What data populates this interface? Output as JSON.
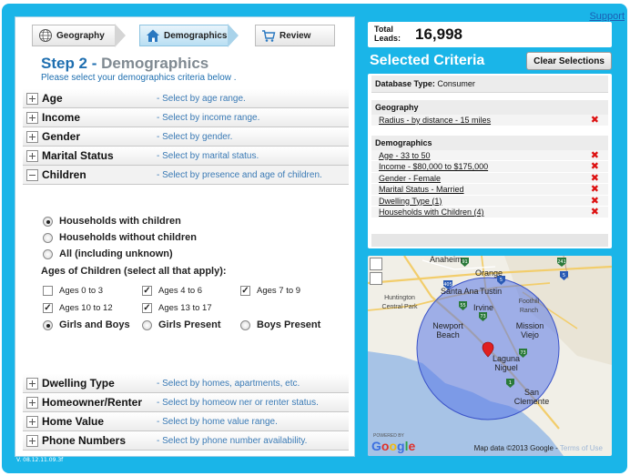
{
  "header": {
    "support_link": "Support"
  },
  "version": "V. 08.12.11.09.3f",
  "steps": [
    {
      "label": "Geography",
      "icon": "globe-icon"
    },
    {
      "label": "Demographics",
      "icon": "house-icon"
    },
    {
      "label": "Review",
      "icon": "cart-icon"
    }
  ],
  "step_heading": {
    "prefix": "Step 2",
    "sep": " - ",
    "name": "Demographics"
  },
  "step_subtitle": "Please select your demographics criteria below .",
  "criteria_rows_top": [
    {
      "label": "Age",
      "hint": "- Select by age range."
    },
    {
      "label": "Income",
      "hint": "- Select by income range."
    },
    {
      "label": "Gender",
      "hint": "- Select by gender."
    },
    {
      "label": "Marital Status",
      "hint": "- Select by marital status."
    },
    {
      "label": "Children",
      "hint": "- Select by presence and age of children."
    }
  ],
  "children": {
    "household_options": [
      {
        "label": "Households with children",
        "selected": true
      },
      {
        "label": "Households without children",
        "selected": false
      },
      {
        "label": "All (including unknown)",
        "selected": false
      }
    ],
    "ages_title": "Ages of Children (select all that apply):",
    "age_checks": [
      {
        "label": "Ages 0 to 3",
        "checked": false
      },
      {
        "label": "Ages 4 to 6",
        "checked": true
      },
      {
        "label": "Ages 7 to 9",
        "checked": true
      },
      {
        "label": "Ages 10 to 12",
        "checked": true
      },
      {
        "label": "Ages 13 to 17",
        "checked": true
      }
    ],
    "gender_options": [
      {
        "label": "Girls and Boys",
        "selected": true
      },
      {
        "label": "Girls Present",
        "selected": false
      },
      {
        "label": "Boys Present",
        "selected": false
      }
    ]
  },
  "criteria_rows_bottom": [
    {
      "label": "Dwelling Type",
      "hint": "- Select by homes, apartments, etc."
    },
    {
      "label": "Homeowner/Renter",
      "hint": "- Select by homeow ner or renter status."
    },
    {
      "label": "Home Value",
      "hint": "- Select by home value range."
    },
    {
      "label": "Phone Numbers",
      "hint": "- Select by phone number availability."
    }
  ],
  "leads": {
    "label_line1": "Total",
    "label_line2": "Leads:",
    "count": "16,998"
  },
  "selected_criteria": {
    "title": "Selected Criteria",
    "clear_button": "Clear Selections",
    "db_type_label": "Database Type:",
    "db_type_value": "Consumer",
    "geography_title": "Geography",
    "geography_items": [
      "Radius - by distance - 15 miles"
    ],
    "demographics_title": "Demographics",
    "demographics_items": [
      "Age - 33 to 50",
      "Income - $80,000 to $175,000",
      "Gender - Female",
      "Marital Status - Married",
      "Dwelling Type (1)",
      "Households with Children (4)"
    ],
    "remove_glyph": "✖",
    "remove_color": "#dd1111"
  },
  "map": {
    "places": [
      "Anaheim",
      "Orange",
      "Santa Ana",
      "Tustin",
      "Irvine",
      "Newport Beach",
      "Mission Viejo",
      "Laguna Niguel",
      "San Clemente",
      "Foothill Ranch",
      "Huntington Central Park"
    ],
    "highways": [
      "405",
      "5",
      "5",
      "241",
      "73",
      "73",
      "55",
      "1",
      "91"
    ],
    "attribution": "Map data ©2013 Google - ",
    "terms": "Terms of Use",
    "powered_by": "POWERED BY",
    "logo": "Google",
    "radius_color": "#5a78e8"
  },
  "colors": {
    "frame": "#1ab5e8",
    "accent": "#1f6fb0",
    "hint": "#3a7ab5"
  }
}
